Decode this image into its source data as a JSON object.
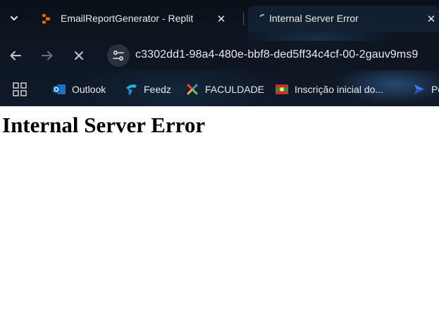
{
  "tabs": [
    {
      "title": "EmailReportGenerator - Replit",
      "active": false
    },
    {
      "title": "Internal Server Error",
      "active": true
    }
  ],
  "address_bar": {
    "url": "c3302dd1-98a4-480e-bbf8-ded5ff34c4cf-00-2gauv9ms9"
  },
  "bookmarks": [
    {
      "label": "Outlook",
      "icon": "outlook-icon"
    },
    {
      "label": "Feedz",
      "icon": "feedz-icon"
    },
    {
      "label": "FACULDADE",
      "icon": "joomla-icon"
    },
    {
      "label": "Inscrição inicial do...",
      "icon": "flag-icon"
    },
    {
      "label": "Po",
      "icon": "arrow-icon"
    }
  ],
  "page": {
    "heading": "Internal Server Error"
  },
  "colors": {
    "heading_text": "#000000",
    "chrome_text": "#e8eaed",
    "replit_orange": "#f26207"
  }
}
